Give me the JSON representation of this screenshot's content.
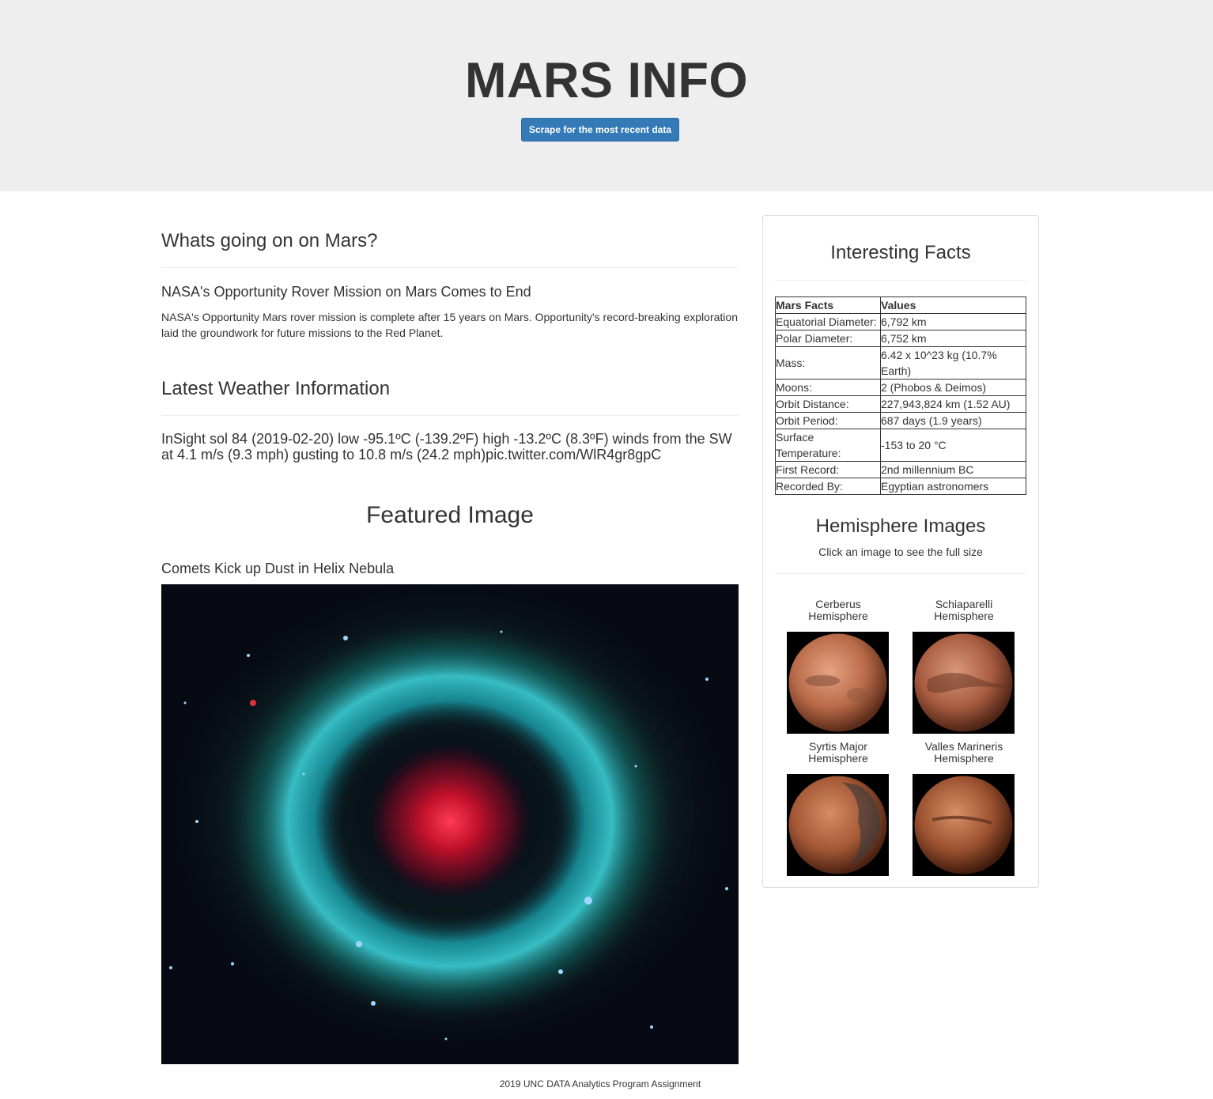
{
  "header": {
    "title": "MARS INFO",
    "button_label": "Scrape for the most recent data"
  },
  "news": {
    "section_heading": "Whats going on on Mars?",
    "title": "NASA's Opportunity Rover Mission on Mars Comes to End",
    "paragraph": "NASA's Opportunity Mars rover mission is complete after 15 years on Mars. Opportunity's record-breaking exploration laid the groundwork for future missions to the Red Planet."
  },
  "weather": {
    "section_heading": "Latest Weather Information",
    "text": "InSight sol 84 (2019-02-20) low -95.1ºC (-139.2ºF) high -13.2ºC (8.3ºF) winds from the SW at 4.1 m/s (9.3 mph) gusting to 10.8 m/s (24.2 mph)pic.twitter.com/WlR4gr8gpC"
  },
  "featured": {
    "section_heading": "Featured Image",
    "title": "Comets Kick up Dust in Helix Nebula"
  },
  "facts": {
    "heading": "Interesting Facts",
    "columns": [
      "Mars Facts",
      "Values"
    ],
    "rows": [
      [
        "Equatorial Diameter:",
        "6,792 km"
      ],
      [
        "Polar Diameter:",
        "6,752 km"
      ],
      [
        "Mass:",
        "6.42 x 10^23 kg (10.7% Earth)"
      ],
      [
        "Moons:",
        "2 (Phobos & Deimos)"
      ],
      [
        "Orbit Distance:",
        "227,943,824 km (1.52 AU)"
      ],
      [
        "Orbit Period:",
        "687 days (1.9 years)"
      ],
      [
        "Surface Temperature:",
        "-153 to 20 °C"
      ],
      [
        "First Record:",
        "2nd millennium BC"
      ],
      [
        "Recorded By:",
        "Egyptian astronomers"
      ]
    ]
  },
  "hemispheres": {
    "heading": "Hemisphere Images",
    "subtitle": "Click an image to see the full size",
    "items": [
      {
        "label": "Cerberus Hemisphere"
      },
      {
        "label": "Schiaparelli Hemisphere"
      },
      {
        "label": "Syrtis Major Hemisphere"
      },
      {
        "label": "Valles Marineris Hemisphere"
      }
    ]
  },
  "footer": {
    "text": "2019 UNC DATA Analytics Program Assignment"
  }
}
